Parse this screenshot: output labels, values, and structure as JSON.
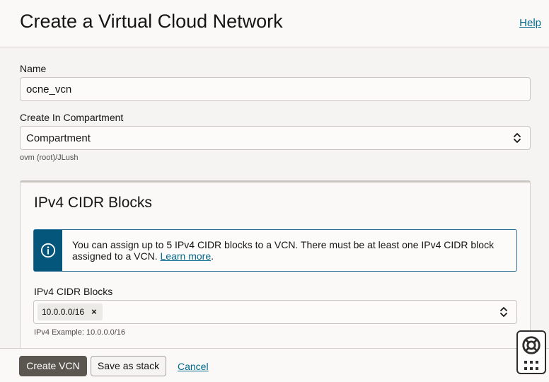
{
  "header": {
    "title": "Create a Virtual Cloud Network",
    "help_label": "Help"
  },
  "form": {
    "name_label": "Name",
    "name_value": "ocne_vcn",
    "compartment_label": "Create In Compartment",
    "compartment_value": "Compartment",
    "compartment_hint": "ovm (root)/JLush"
  },
  "cidr_section": {
    "title": "IPv4 CIDR Blocks",
    "info_text": "You can assign up to 5 IPv4 CIDR blocks to a VCN. There must be at least one IPv4 CIDR block assigned to a VCN.",
    "learn_more_label": "Learn more",
    "info_text_end": ".",
    "field_label": "IPv4 CIDR Blocks",
    "chips": [
      "10.0.0.0/16"
    ],
    "chip_remove_symbol": "×",
    "example_hint": "IPv4 Example: 10.0.0.0/16"
  },
  "footer": {
    "create_label": "Create VCN",
    "save_stack_label": "Save as stack",
    "cancel_label": "Cancel"
  },
  "icons": {
    "info": "info-circle-icon",
    "select": "chevron-up-down-icon",
    "chip_remove": "close-icon",
    "help_widget": "lifebuoy-icon",
    "apps": "grid-icon"
  },
  "colors": {
    "accent_link": "#00688c",
    "info_banner": "#04567a",
    "primary_button": "#5c5651"
  }
}
